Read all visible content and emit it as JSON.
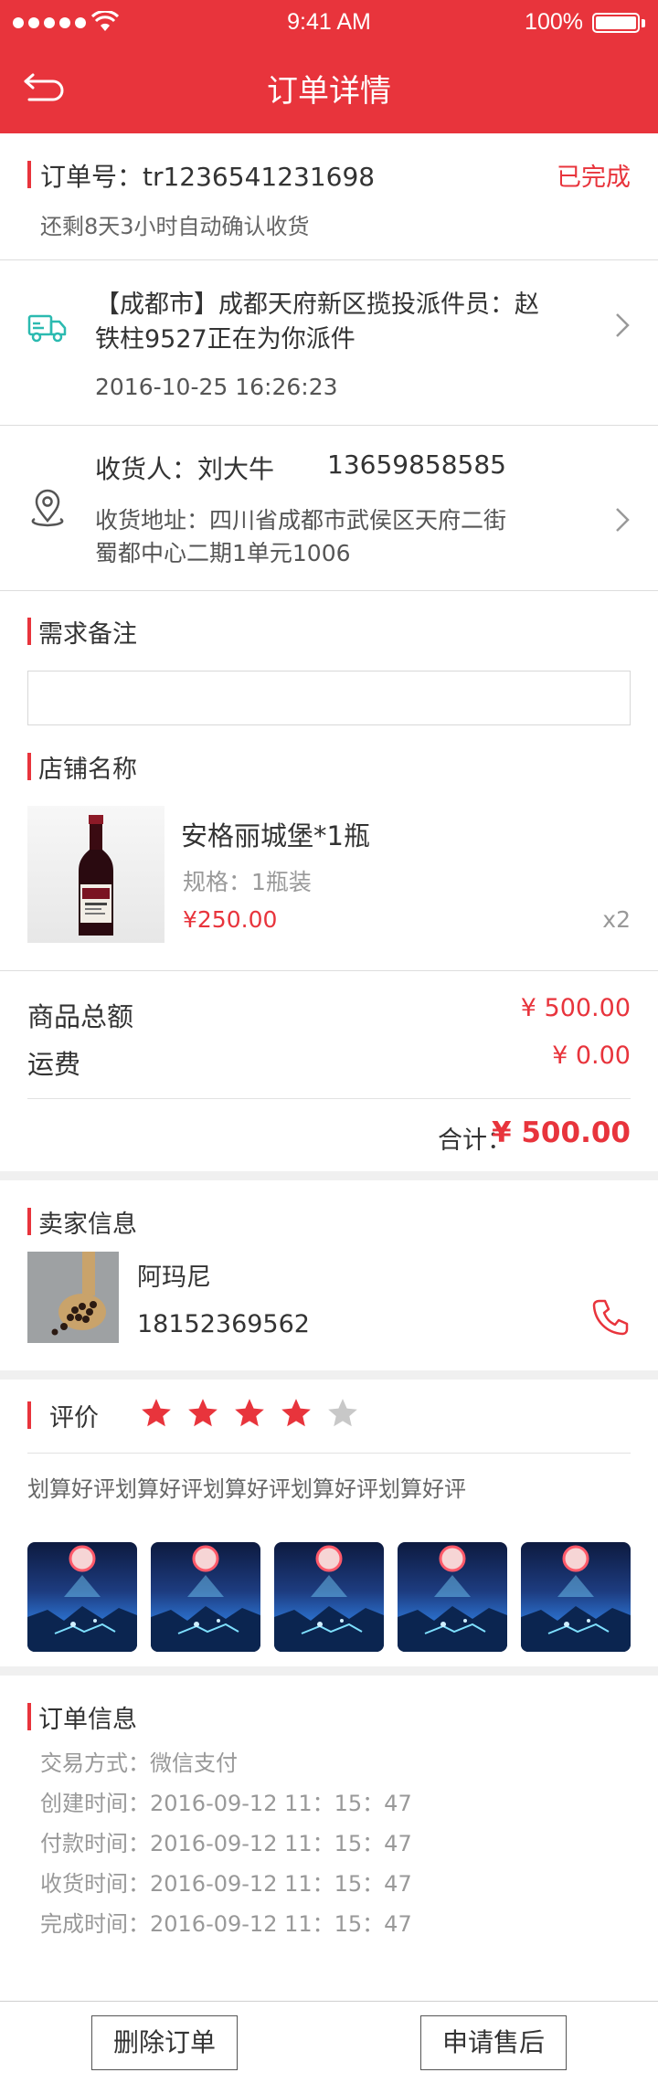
{
  "status_bar": {
    "time": "9:41 AM",
    "battery": "100%"
  },
  "nav": {
    "title": "订单详情"
  },
  "order": {
    "number_label": "订单号：tr1236541231698",
    "status": "已完成",
    "auto_confirm": "还剩8天3小时自动确认收货"
  },
  "logistics": {
    "line1": "【成都市】成都天府新区揽投派件员：赵",
    "line2": "铁柱9527正在为你派件",
    "time": "2016-10-25    16:26:23"
  },
  "address": {
    "recipient": "收货人：刘大牛",
    "phone": "13659858585",
    "line1": "收货地址：四川省成都市武侯区天府二街",
    "line2": "蜀都中心二期1单元1006"
  },
  "remarks": {
    "title": "需求备注"
  },
  "shop": {
    "title": "店铺名称"
  },
  "product": {
    "name": "安格丽城堡*1瓶",
    "spec": "规格：1瓶装",
    "price": "¥250.00",
    "qty": "x2"
  },
  "summary": {
    "goods_label": "商品总额",
    "goods_value": "¥ 500.00",
    "shipping_label": "运费",
    "shipping_value": "¥ 0.00",
    "total_label": "合计：",
    "total_value": "¥ 500.00"
  },
  "seller": {
    "title": "卖家信息",
    "name": "阿玛尼",
    "phone": "18152369562"
  },
  "review": {
    "title": "评价",
    "rating": 4,
    "max_rating": 5,
    "text": "划算好评划算好评划算好评划算好评划算好评"
  },
  "order_info": {
    "title": "订单信息",
    "rows": [
      "交易方式：微信支付",
      "创建时间：2016-09-12      11：15：47",
      "付款时间：2016-09-12      11：15：47",
      "收货时间：2016-09-12      11：15：47",
      "完成时间：2016-09-12      11：15：47"
    ]
  },
  "actions": {
    "delete": "删除订单",
    "after_sale": "申请售后"
  },
  "colors": {
    "accent": "#e8343c",
    "star_on": "#e8343c",
    "star_off": "#c8c8c8",
    "truck": "#2bbab0"
  }
}
